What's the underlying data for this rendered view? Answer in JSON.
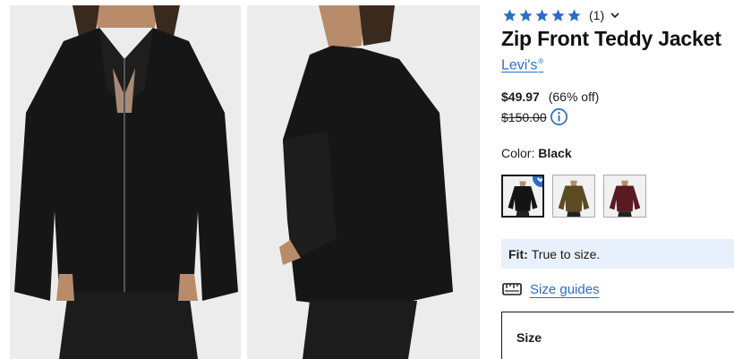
{
  "product": {
    "title": "Zip Front Teddy Jacket",
    "brand": "Levi's",
    "brand_mark": "®",
    "rating": 5,
    "review_count": "(1)"
  },
  "pricing": {
    "current": "$49.97",
    "discount": "(66% off)",
    "original": "$150.00"
  },
  "color": {
    "label": "Color:",
    "selected": "Black",
    "swatches": [
      {
        "name": "Black",
        "hex": "#141414",
        "selected": true
      },
      {
        "name": "Olive",
        "hex": "#5c4a22",
        "selected": false
      },
      {
        "name": "Burgundy",
        "hex": "#5a1a22",
        "selected": false
      }
    ]
  },
  "fit": {
    "label": "Fit:",
    "value": "True to size."
  },
  "size_guides": {
    "label": "Size guides",
    "icon": "ruler-icon"
  },
  "size": {
    "label": "Size"
  },
  "colors": {
    "accent": "#2a6dc9",
    "star": "#2a6dc9",
    "fit_background": "#e8f1fb"
  },
  "icons": [
    "star-icon",
    "chevron-down-icon",
    "info-icon",
    "check-icon",
    "ruler-icon"
  ]
}
